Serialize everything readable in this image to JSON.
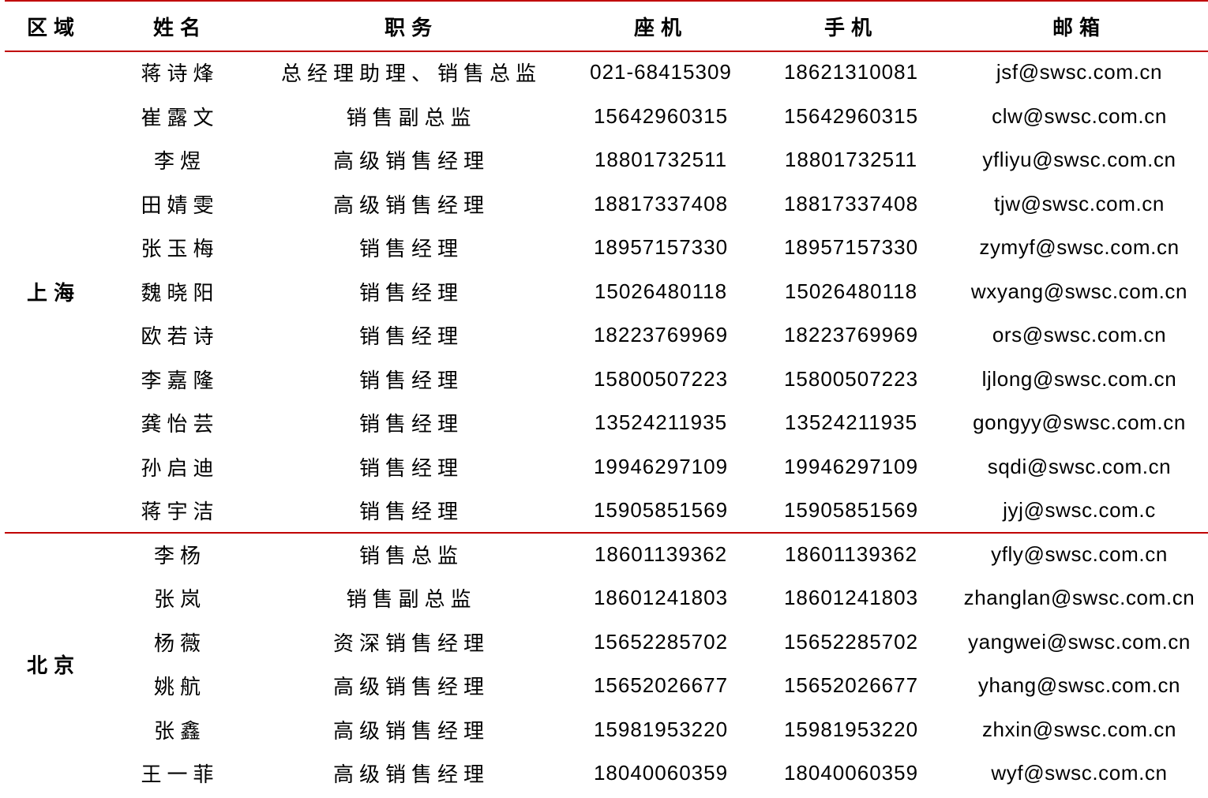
{
  "headers": {
    "region": "区域",
    "name": "姓名",
    "title": "职务",
    "landline": "座机",
    "mobile": "手机",
    "email": "邮箱"
  },
  "regions": [
    {
      "name": "上海",
      "contacts": [
        {
          "name": "蒋诗烽",
          "title": "总经理助理、销售总监",
          "landline": "021-68415309",
          "mobile": "18621310081",
          "email": "jsf@swsc.com.cn"
        },
        {
          "name": "崔露文",
          "title": "销售副总监",
          "landline": "15642960315",
          "mobile": "15642960315",
          "email": "clw@swsc.com.cn"
        },
        {
          "name": "李煜",
          "title": "高级销售经理",
          "landline": "18801732511",
          "mobile": "18801732511",
          "email": "yfliyu@swsc.com.cn"
        },
        {
          "name": "田婧雯",
          "title": "高级销售经理",
          "landline": "18817337408",
          "mobile": "18817337408",
          "email": "tjw@swsc.com.cn"
        },
        {
          "name": "张玉梅",
          "title": "销售经理",
          "landline": "18957157330",
          "mobile": "18957157330",
          "email": "zymyf@swsc.com.cn"
        },
        {
          "name": "魏晓阳",
          "title": "销售经理",
          "landline": "15026480118",
          "mobile": "15026480118",
          "email": "wxyang@swsc.com.cn"
        },
        {
          "name": "欧若诗",
          "title": "销售经理",
          "landline": "18223769969",
          "mobile": "18223769969",
          "email": "ors@swsc.com.cn"
        },
        {
          "name": "李嘉隆",
          "title": "销售经理",
          "landline": "15800507223",
          "mobile": "15800507223",
          "email": "ljlong@swsc.com.cn"
        },
        {
          "name": "龚怡芸",
          "title": "销售经理",
          "landline": "13524211935",
          "mobile": "13524211935",
          "email": "gongyy@swsc.com.cn"
        },
        {
          "name": "孙启迪",
          "title": "销售经理",
          "landline": "19946297109",
          "mobile": "19946297109",
          "email": "sqdi@swsc.com.cn"
        },
        {
          "name": "蒋宇洁",
          "title": "销售经理",
          "landline": "15905851569",
          "mobile": "15905851569",
          "email": "jyj@swsc.com.c"
        }
      ]
    },
    {
      "name": "北京",
      "contacts": [
        {
          "name": "李杨",
          "title": "销售总监",
          "landline": "18601139362",
          "mobile": "18601139362",
          "email": "yfly@swsc.com.cn"
        },
        {
          "name": "张岚",
          "title": "销售副总监",
          "landline": "18601241803",
          "mobile": "18601241803",
          "email": "zhanglan@swsc.com.cn"
        },
        {
          "name": "杨薇",
          "title": "资深销售经理",
          "landline": "15652285702",
          "mobile": "15652285702",
          "email": "yangwei@swsc.com.cn"
        },
        {
          "name": "姚航",
          "title": "高级销售经理",
          "landline": "15652026677",
          "mobile": "15652026677",
          "email": "yhang@swsc.com.cn"
        },
        {
          "name": "张鑫",
          "title": "高级销售经理",
          "landline": "15981953220",
          "mobile": "15981953220",
          "email": "zhxin@swsc.com.cn"
        },
        {
          "name": "王一菲",
          "title": "高级销售经理",
          "landline": "18040060359",
          "mobile": "18040060359",
          "email": "wyf@swsc.com.cn"
        }
      ]
    }
  ],
  "colors": {
    "rule": "#c00000",
    "text": "#000000"
  }
}
